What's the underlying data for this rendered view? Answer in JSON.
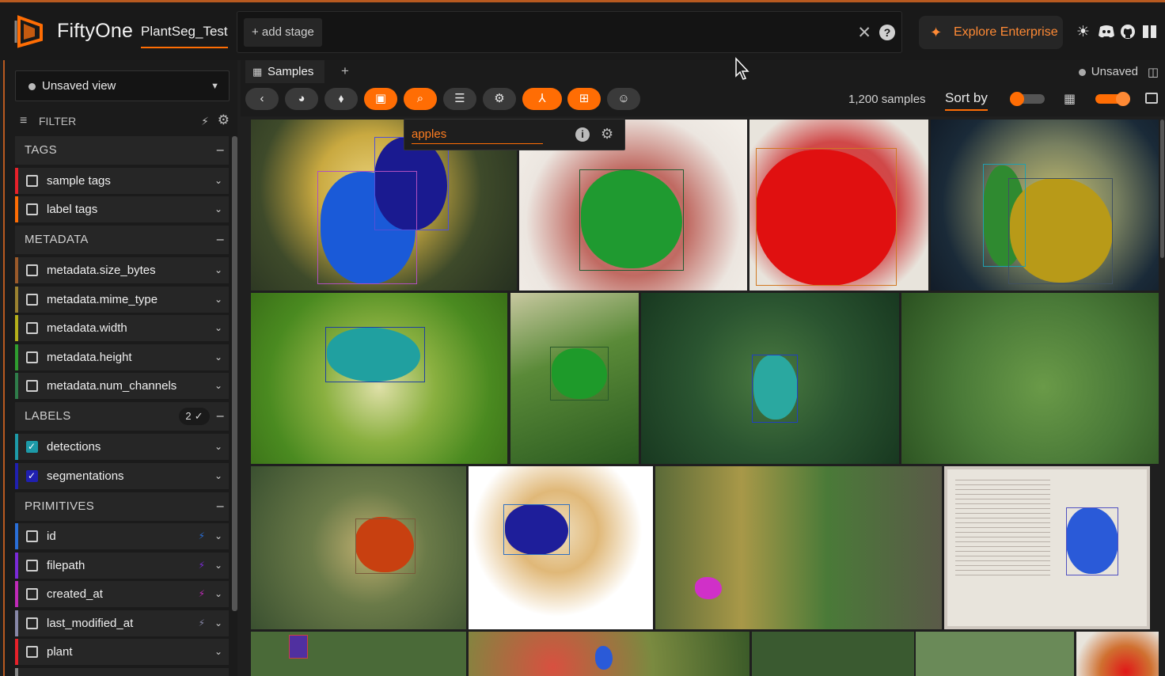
{
  "app": {
    "brand": "FiftyOne",
    "dataset": "PlantSeg_Test",
    "add_stage": "+ add stage",
    "explore": "Explore Enterprise"
  },
  "sidebar": {
    "view": "Unsaved view",
    "filter_label": "FILTER",
    "sections": {
      "tags": "TAGS",
      "metadata": "METADATA",
      "labels": "LABELS",
      "labels_count": "2 ✓",
      "primitives": "PRIMITIVES"
    },
    "items": [
      {
        "label": "sample tags",
        "color": "#e8212a",
        "checked": false
      },
      {
        "label": "label tags",
        "color": "#ff6d04",
        "checked": false
      },
      {
        "label": "metadata.size_bytes",
        "color": "#9b5a2a",
        "checked": false
      },
      {
        "label": "metadata.mime_type",
        "color": "#9b8230",
        "checked": false
      },
      {
        "label": "metadata.width",
        "color": "#b5b01a",
        "checked": false
      },
      {
        "label": "metadata.height",
        "color": "#2f9d2f",
        "checked": false
      },
      {
        "label": "metadata.num_channels",
        "color": "#2f7d4a",
        "checked": false
      },
      {
        "label": "detections",
        "color": "#1d9aa8",
        "checked": true
      },
      {
        "label": "segmentations",
        "color": "#2020b0",
        "checked": true
      },
      {
        "label": "id",
        "color": "#2a6fd8",
        "checked": false
      },
      {
        "label": "filepath",
        "color": "#7b2ad8",
        "checked": false
      },
      {
        "label": "created_at",
        "color": "#c02ab8",
        "checked": false
      },
      {
        "label": "last_modified_at",
        "color": "#8888a8",
        "checked": false
      },
      {
        "label": "plant",
        "color": "#e8212a",
        "checked": false
      }
    ]
  },
  "main": {
    "tab": "Samples",
    "status": "Unsaved",
    "sample_count": "1,200 samples",
    "sort_by": "Sort by",
    "search_query": "apples"
  },
  "icons": [
    "logo-icon",
    "close-icon",
    "help-icon",
    "sparkle-icon",
    "sun-icon",
    "discord-icon",
    "github-icon",
    "book-icon",
    "back-icon",
    "palette-icon",
    "tag-icon",
    "patches-icon",
    "search-icon",
    "list-icon",
    "gear-icon",
    "similarity-icon",
    "eval-icon",
    "emoji-icon",
    "grid-icon",
    "layout-icon"
  ]
}
